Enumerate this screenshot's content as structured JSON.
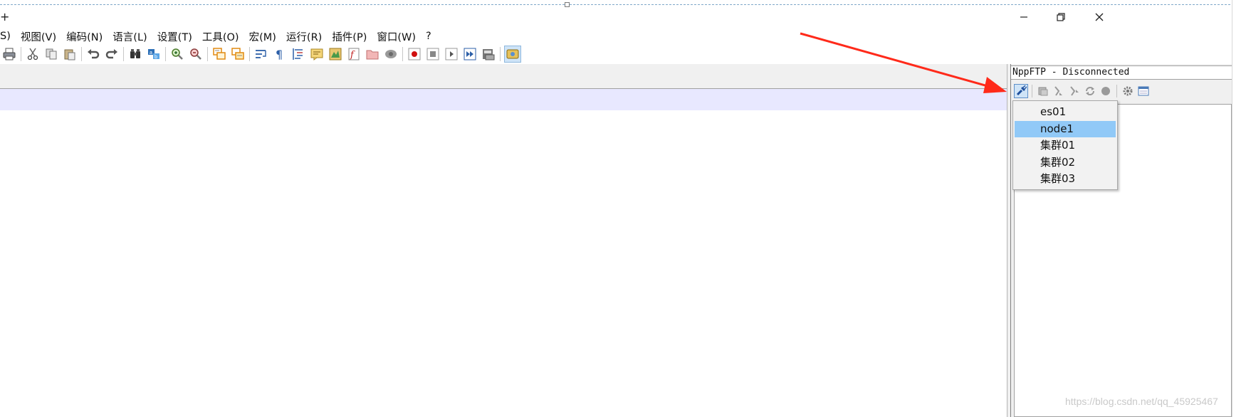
{
  "window": {
    "title_fragment": "+",
    "controls": {
      "minimize_icon": "minimize-icon",
      "restore_icon": "restore-icon",
      "close_icon": "close-icon"
    }
  },
  "menu": {
    "items": [
      "S)",
      "视图(V)",
      "编码(N)",
      "语言(L)",
      "设置(T)",
      "工具(O)",
      "宏(M)",
      "运行(R)",
      "插件(P)",
      "窗口(W)",
      "?"
    ]
  },
  "toolbar": {
    "buttons": [
      "print",
      "cut",
      "copy",
      "paste",
      "undo",
      "redo",
      "find",
      "replace",
      "zoom-in",
      "zoom-out",
      "sync-vertical",
      "sync-horizontal",
      "word-wrap",
      "show-all-chars",
      "indent-guide",
      "udl",
      "doc-map",
      "function-list",
      "folder-workspace",
      "monitoring",
      "record-macro",
      "stop-record",
      "play-macro",
      "run-macro-multiple",
      "save-macro",
      "nppftp-show"
    ]
  },
  "ftp_panel": {
    "caption": "NppFTP - Disconnected",
    "toolbar": [
      "connect",
      "download",
      "upload",
      "refresh",
      "abort",
      "settings",
      "message-window"
    ]
  },
  "dropdown": {
    "items": [
      "es01",
      "node1",
      "集群01",
      "集群02",
      "集群03"
    ],
    "highlighted": "node1"
  },
  "colors": {
    "current_line": "#e8e8ff",
    "highlight": "#91c9f7",
    "arrow": "#ff2a1a"
  },
  "watermark": "https://blog.csdn.net/qq_45925467"
}
